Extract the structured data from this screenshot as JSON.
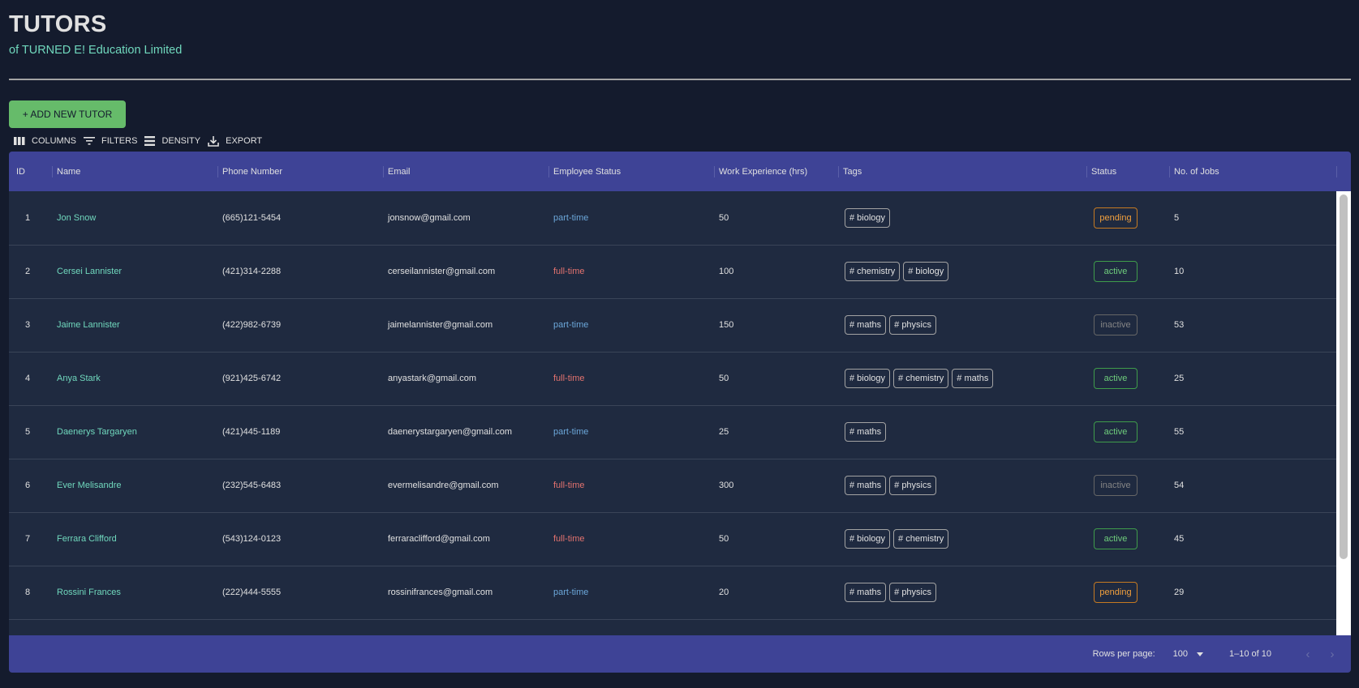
{
  "header": {
    "title": "TUTORS",
    "subtitle": "of TURNED E! Education Limited"
  },
  "actions": {
    "add_button_label": "+ ADD NEW TUTOR"
  },
  "toolbar": {
    "columns_label": "COLUMNS",
    "filters_label": "FILTERS",
    "density_label": "DENSITY",
    "export_label": "EXPORT"
  },
  "table": {
    "columns": [
      "ID",
      "Name",
      "Phone Number",
      "Email",
      "Employee Status",
      "Work Experience (hrs)",
      "Tags",
      "Status",
      "No. of Jobs"
    ],
    "rows": [
      {
        "id": "1",
        "name": "Jon Snow",
        "phone": "(665)121-5454",
        "email": "jonsnow@gmail.com",
        "employee_status": "part-time",
        "experience": "50",
        "tags": [
          "# biology"
        ],
        "status": "pending",
        "jobs": "5"
      },
      {
        "id": "2",
        "name": "Cersei Lannister",
        "phone": "(421)314-2288",
        "email": "cerseilannister@gmail.com",
        "employee_status": "full-time",
        "experience": "100",
        "tags": [
          "# chemistry",
          "# biology"
        ],
        "status": "active",
        "jobs": "10"
      },
      {
        "id": "3",
        "name": "Jaime Lannister",
        "phone": "(422)982-6739",
        "email": "jaimelannister@gmail.com",
        "employee_status": "part-time",
        "experience": "150",
        "tags": [
          "# maths",
          "# physics"
        ],
        "status": "inactive",
        "jobs": "53"
      },
      {
        "id": "4",
        "name": "Anya Stark",
        "phone": "(921)425-6742",
        "email": "anyastark@gmail.com",
        "employee_status": "full-time",
        "experience": "50",
        "tags": [
          "# biology",
          "# chemistry",
          "# maths"
        ],
        "status": "active",
        "jobs": "25"
      },
      {
        "id": "5",
        "name": "Daenerys Targaryen",
        "phone": "(421)445-1189",
        "email": "daenerystargaryen@gmail.com",
        "employee_status": "part-time",
        "experience": "25",
        "tags": [
          "# maths"
        ],
        "status": "active",
        "jobs": "55"
      },
      {
        "id": "6",
        "name": "Ever Melisandre",
        "phone": "(232)545-6483",
        "email": "evermelisandre@gmail.com",
        "employee_status": "full-time",
        "experience": "300",
        "tags": [
          "# maths",
          "# physics"
        ],
        "status": "inactive",
        "jobs": "54"
      },
      {
        "id": "7",
        "name": "Ferrara Clifford",
        "phone": "(543)124-0123",
        "email": "ferraraclifford@gmail.com",
        "employee_status": "full-time",
        "experience": "50",
        "tags": [
          "# biology",
          "# chemistry"
        ],
        "status": "active",
        "jobs": "45"
      },
      {
        "id": "8",
        "name": "Rossini Frances",
        "phone": "(222)444-5555",
        "email": "rossinifrances@gmail.com",
        "employee_status": "part-time",
        "experience": "20",
        "tags": [
          "# maths",
          "# physics"
        ],
        "status": "pending",
        "jobs": "29"
      }
    ]
  },
  "pagination": {
    "rows_per_page_label": "Rows per page:",
    "rows_per_page_value": "100",
    "range_label": "1–10 of 10",
    "prev_icon": "chevron-left-icon",
    "next_icon": "chevron-right-icon"
  },
  "colors": {
    "background": "#141b2d",
    "header_bg": "#3e4396",
    "row_bg": "#1f2a40",
    "accent_green": "#70d8bd",
    "add_button": "#66bb6a",
    "part_time": "#6ba6d8",
    "full_time": "#e2726e",
    "pending": "#f2a03d",
    "active": "#6fce7c",
    "inactive": "#858585"
  }
}
